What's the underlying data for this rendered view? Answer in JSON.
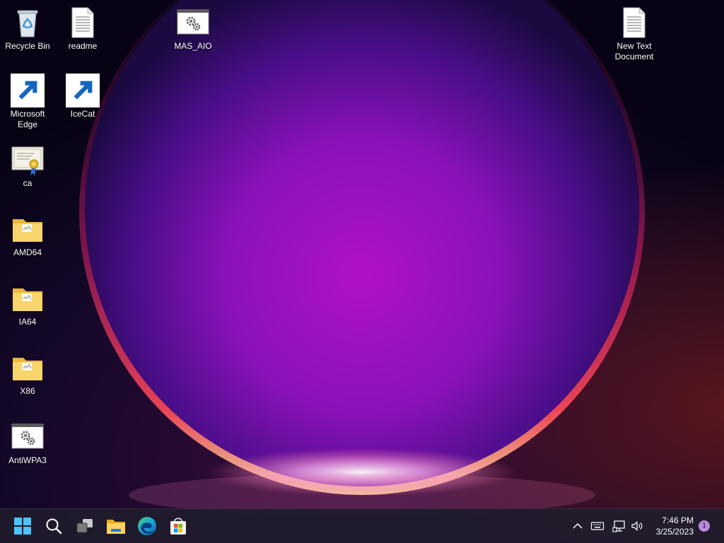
{
  "desktop": {
    "icons": [
      {
        "label": "Recycle Bin",
        "icon": "recycle-bin-icon"
      },
      {
        "label": "readme",
        "icon": "text-document-icon"
      },
      {
        "label": "MAS_AIO",
        "icon": "batch-file-icon"
      },
      {
        "label": "New Text Document",
        "icon": "text-document-icon"
      },
      {
        "label": "Microsoft Edge",
        "icon": "edge-icon"
      },
      {
        "label": "IceCat",
        "icon": "icecat-icon"
      },
      {
        "label": "ca",
        "icon": "certificate-icon"
      },
      {
        "label": "AMD64",
        "icon": "folder-icon"
      },
      {
        "label": "IA64",
        "icon": "folder-icon"
      },
      {
        "label": "X86",
        "icon": "folder-icon"
      },
      {
        "label": "AntiWPA3",
        "icon": "batch-file-icon"
      }
    ]
  },
  "taskbar": {
    "apps": [
      {
        "name": "Start",
        "icon": "windows-start-icon"
      },
      {
        "name": "Search",
        "icon": "search-icon"
      },
      {
        "name": "Task View",
        "icon": "task-view-icon"
      },
      {
        "name": "File Explorer",
        "icon": "file-explorer-icon"
      },
      {
        "name": "Microsoft Edge",
        "icon": "edge-icon"
      },
      {
        "name": "Microsoft Store",
        "icon": "store-icon"
      }
    ],
    "tray": {
      "icons": [
        "chevron-up-icon",
        "keyboard-icon",
        "network-icon",
        "volume-icon"
      ],
      "time": "7:46 PM",
      "date": "3/25/2023",
      "notification_count": "1"
    }
  },
  "colors": {
    "accent": "#0078d4",
    "taskbar": "#201c2c",
    "notification_badge": "#b98ad9"
  }
}
